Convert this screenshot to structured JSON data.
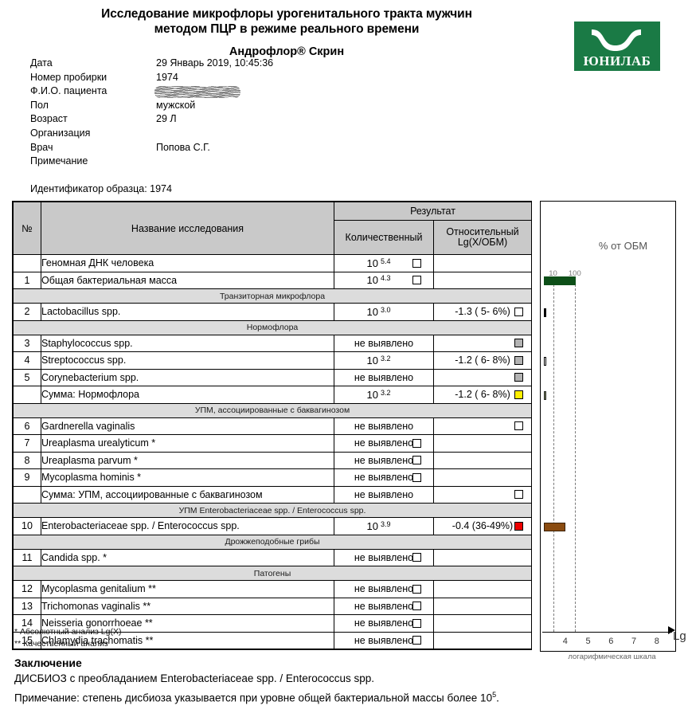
{
  "header": {
    "title_line1": "Исследование микрофлоры урогенитального тракта мужчин",
    "title_line2": "методом ПЦР в режиме реального времени",
    "subtitle": "Андрофлор® Скрин",
    "logo_text": "ЮНИЛАБ",
    "logo_color": "#1a7a45"
  },
  "meta": [
    {
      "label": "Дата",
      "value": "29 Январь 2019, 10:45:36",
      "redacted": false
    },
    {
      "label": "Номер пробирки",
      "value": "1974",
      "redacted": false
    },
    {
      "label": "Ф.И.О. пациента",
      "value": "",
      "redacted": true
    },
    {
      "label": "Пол",
      "value": "мужской",
      "redacted": false
    },
    {
      "label": "Возраст",
      "value": "29 Л",
      "redacted": false
    },
    {
      "label": "Организация",
      "value": "",
      "redacted": false
    },
    {
      "label": "Врач",
      "value": "Попова С.Г.",
      "redacted": false
    },
    {
      "label": "Примечание",
      "value": "",
      "redacted": false
    }
  ],
  "sample_id": "Идентификатор образца: 1974",
  "table": {
    "headers": {
      "num": "№",
      "name": "Название исследования",
      "result": "Результат",
      "quantitative": "Количественный",
      "relative_line1": "Относительный",
      "relative_line2": "Lg(X/ОБМ)"
    },
    "not_detected": "не выявлено",
    "rows": [
      {
        "kind": "data",
        "num": "",
        "name": "Геномная ДНК человека",
        "quant_base": "10",
        "quant_exp": "5.4",
        "quant_nd": "",
        "quant_flag": "white",
        "rel": "",
        "rel_flag": ""
      },
      {
        "kind": "data",
        "num": "1",
        "name": "Общая бактериальная масса",
        "quant_base": "10",
        "quant_exp": "4.3",
        "quant_nd": "",
        "quant_flag": "white",
        "rel": "",
        "rel_flag": ""
      },
      {
        "kind": "group",
        "label": "Транзиторная микрофлора"
      },
      {
        "kind": "data",
        "num": "2",
        "name": "Lactobacillus spp.",
        "quant_base": "10",
        "quant_exp": "3.0",
        "quant_nd": "",
        "quant_flag": "",
        "rel": "-1.3 ( 5- 6%)",
        "rel_flag": "white"
      },
      {
        "kind": "group",
        "label": "Нормофлора"
      },
      {
        "kind": "data",
        "num": "3",
        "name": "Staphylococcus spp.",
        "quant_base": "",
        "quant_exp": "",
        "quant_nd": "не выявлено",
        "quant_flag": "",
        "rel": "",
        "rel_flag": "grey"
      },
      {
        "kind": "data",
        "num": "4",
        "name": "Streptococcus spp.",
        "quant_base": "10",
        "quant_exp": "3.2",
        "quant_nd": "",
        "quant_flag": "",
        "rel": "-1.2 ( 6- 8%)",
        "rel_flag": "grey"
      },
      {
        "kind": "data",
        "num": "5",
        "name": "Corynebacterium spp.",
        "quant_base": "",
        "quant_exp": "",
        "quant_nd": "не выявлено",
        "quant_flag": "",
        "rel": "",
        "rel_flag": "grey"
      },
      {
        "kind": "data",
        "num": "",
        "name": "Сумма: Нормофлора",
        "quant_base": "10",
        "quant_exp": "3.2",
        "quant_nd": "",
        "quant_flag": "",
        "rel": "-1.2 ( 6- 8%)",
        "rel_flag": "yellow"
      },
      {
        "kind": "group",
        "label": "УПМ, ассоциированные с баквагинозом"
      },
      {
        "kind": "data",
        "num": "6",
        "name": "Gardnerella vaginalis",
        "quant_base": "",
        "quant_exp": "",
        "quant_nd": "не выявлено",
        "quant_flag": "",
        "rel": "",
        "rel_flag": "white"
      },
      {
        "kind": "data",
        "num": "7",
        "name": "Ureaplasma urealyticum *",
        "quant_base": "",
        "quant_exp": "",
        "quant_nd": "не выявлено",
        "quant_flag": "white",
        "rel": "",
        "rel_flag": ""
      },
      {
        "kind": "data",
        "num": "8",
        "name": "Ureaplasma parvum *",
        "quant_base": "",
        "quant_exp": "",
        "quant_nd": "не выявлено",
        "quant_flag": "white",
        "rel": "",
        "rel_flag": ""
      },
      {
        "kind": "data",
        "num": "9",
        "name": "Mycoplasma hominis *",
        "quant_base": "",
        "quant_exp": "",
        "quant_nd": "не выявлено",
        "quant_flag": "white",
        "rel": "",
        "rel_flag": ""
      },
      {
        "kind": "data",
        "num": "",
        "name": "Сумма: УПМ, ассоциированные с баквагинозом",
        "quant_base": "",
        "quant_exp": "",
        "quant_nd": "не выявлено",
        "quant_flag": "",
        "rel": "",
        "rel_flag": "white"
      },
      {
        "kind": "group",
        "label": "УПМ Enterobacteriaceae spp. / Enterococcus spp."
      },
      {
        "kind": "data",
        "num": "10",
        "name": "Enterobacteriaceae spp. / Enterococcus spp.",
        "quant_base": "10",
        "quant_exp": "3.9",
        "quant_nd": "",
        "quant_flag": "",
        "rel": "-0.4 (36-49%)",
        "rel_flag": "red"
      },
      {
        "kind": "group",
        "label": "Дрожжеподобные грибы"
      },
      {
        "kind": "data",
        "num": "11",
        "name": "Candida spp. *",
        "quant_base": "",
        "quant_exp": "",
        "quant_nd": "не выявлено",
        "quant_flag": "white",
        "rel": "",
        "rel_flag": ""
      },
      {
        "kind": "group",
        "label": "Патогены"
      },
      {
        "kind": "data",
        "num": "12",
        "name": "Mycoplasma genitalium **",
        "quant_base": "",
        "quant_exp": "",
        "quant_nd": "не выявлено",
        "quant_flag": "white",
        "rel": "",
        "rel_flag": ""
      },
      {
        "kind": "data",
        "num": "13",
        "name": "Trichomonas vaginalis **",
        "quant_base": "",
        "quant_exp": "",
        "quant_nd": "не выявлено",
        "quant_flag": "white",
        "rel": "",
        "rel_flag": ""
      },
      {
        "kind": "data",
        "num": "14",
        "name": "Neisseria gonorrhoeae **",
        "quant_base": "",
        "quant_exp": "",
        "quant_nd": "не выявлено",
        "quant_flag": "white",
        "rel": "",
        "rel_flag": ""
      },
      {
        "kind": "data",
        "num": "15",
        "name": "Chlamydia trachomatis **",
        "quant_base": "",
        "quant_exp": "",
        "quant_nd": "не выявлено",
        "quant_flag": "white",
        "rel": "",
        "rel_flag": ""
      }
    ]
  },
  "chart_data": {
    "type": "bar",
    "title": "% от ОБМ",
    "xlabel": "Lg",
    "xlabel_caption": "логарифмическая шкала",
    "orientation": "horizontal",
    "xlim": [
      3.0,
      8.6
    ],
    "tick_labels": [
      "4",
      "5",
      "6",
      "7",
      "8"
    ],
    "tick_values": [
      4,
      5,
      6,
      7,
      8
    ],
    "gridlines": [
      {
        "label": "10",
        "value": 3.4
      },
      {
        "label": "100",
        "value": 4.35
      }
    ],
    "grid": true,
    "legend": "none",
    "categories": [
      "Общая бактериальная масса",
      "Lactobacillus spp.",
      "Streptococcus spp.",
      "Сумма: Нормофлора",
      "Enterobacteriaceae spp. / Enterococcus spp."
    ],
    "bars": [
      {
        "row_index": 1,
        "label": "Общая бактериальная масса",
        "value": 4.4,
        "color": "#0d4f18",
        "outline": "#0d4f18"
      },
      {
        "row_index": 3,
        "label": "Lactobacillus spp.",
        "value": 3.05,
        "color": "#000000",
        "outline": "#000000"
      },
      {
        "row_index": 6,
        "label": "Streptococcus spp.",
        "value": 3.1,
        "color": "#ffffff",
        "outline": "#000000"
      },
      {
        "row_index": 8,
        "label": "Сумма: Нормофлора",
        "value": 3.1,
        "color": "#6e7c52",
        "outline": "#2a2a2a"
      },
      {
        "row_index": 16,
        "label": "Enterobacteriaceae spp. / Enterococcus spp.",
        "value": 3.95,
        "color": "#8a4b10",
        "outline": "#3a2206"
      }
    ]
  },
  "footnotes": {
    "line1": "*  Абсолютный анализ Lg(X)",
    "line2": "** Качественный анализ"
  },
  "conclusion": {
    "title": "Заключение",
    "line1": "ДИСБИОЗ с преобладанием Enterobacteriaceae spp. / Enterococcus spp.",
    "line2_pre": "Примечание: степень дисбиоза указывается при уровне общей бактериальной массы более 10",
    "line2_sup": "5",
    "line2_post": "."
  }
}
